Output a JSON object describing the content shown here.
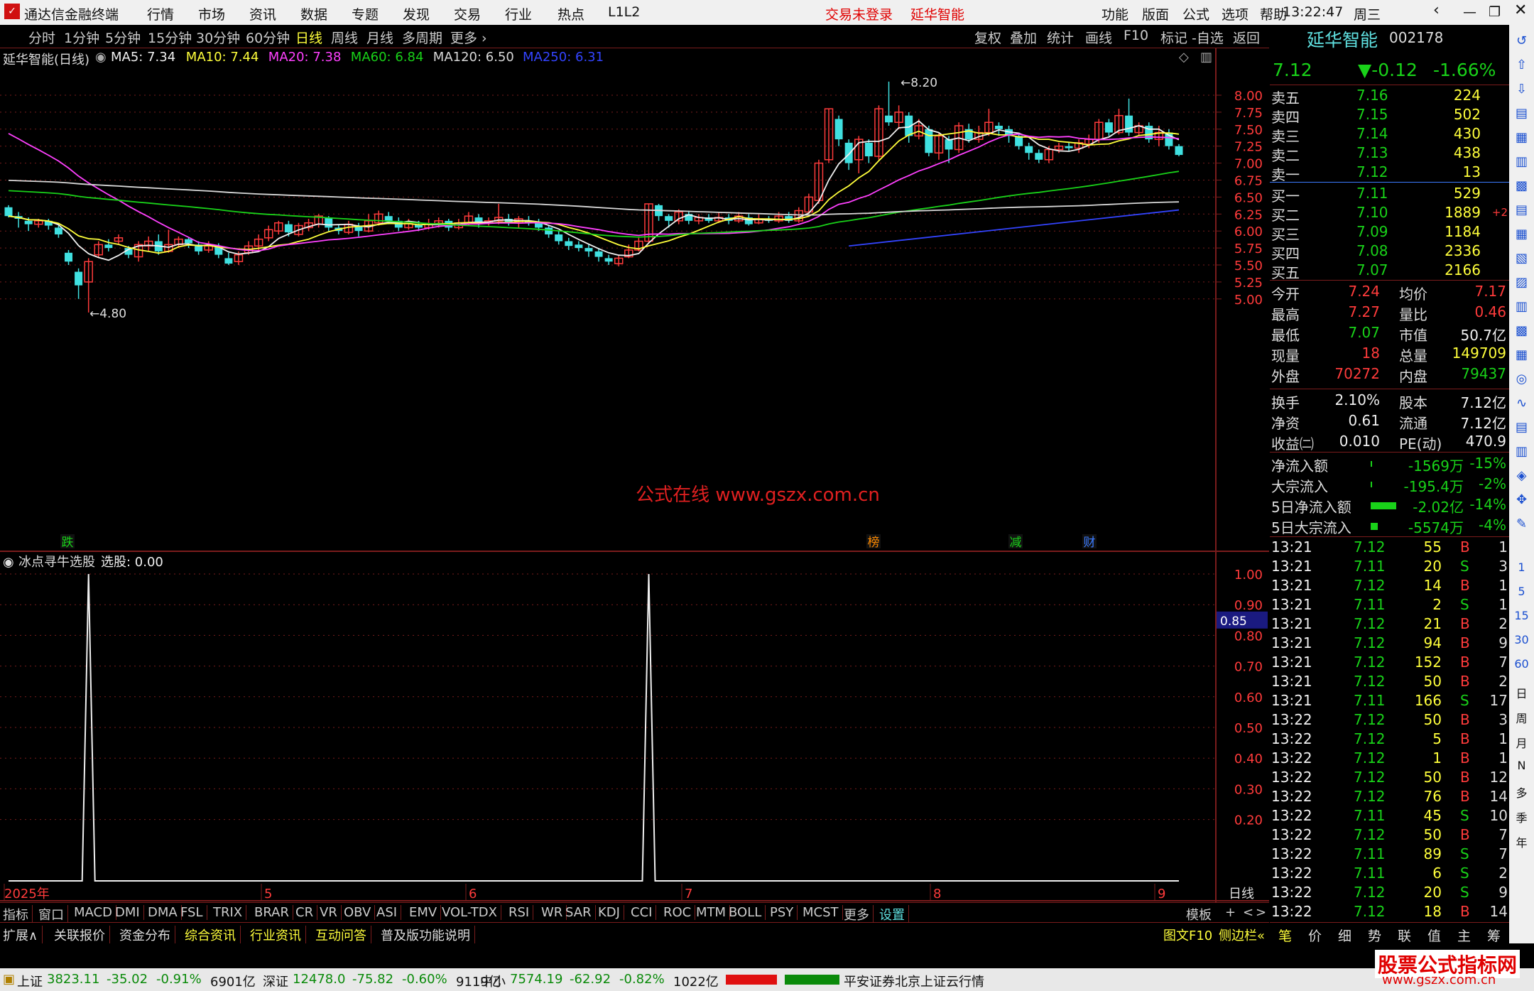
{
  "titlebar": {
    "app": "通达信金融终端",
    "menus": [
      "行情",
      "市场",
      "资讯",
      "数据",
      "专题",
      "发现",
      "交易",
      "行业",
      "热点",
      "L1L2"
    ],
    "login": "交易未登录",
    "stock": "延华智能",
    "right": [
      "功能",
      "版面",
      "公式",
      "选项",
      "帮助"
    ],
    "time": "13:22:47",
    "weekday": "周三"
  },
  "toolbar": {
    "periods": [
      "分时",
      "1分钟",
      "5分钟",
      "15分钟",
      "30分钟",
      "60分钟",
      "日线",
      "周线",
      "月线",
      "多周期",
      "更多"
    ],
    "active": "日线",
    "tools": [
      "复权",
      "叠加",
      "统计",
      "画线",
      "F10",
      "标记",
      "-自选",
      "返回"
    ]
  },
  "ma_info": {
    "name": "延华智能(日线)",
    "items": [
      {
        "label": "MA5: 7.34",
        "color": "#f0f0f0"
      },
      {
        "label": "MA10: 7.44",
        "color": "#ffff3b"
      },
      {
        "label": "MA20: 7.38",
        "color": "#ff40ff"
      },
      {
        "label": "MA60: 6.84",
        "color": "#19d219"
      },
      {
        "label": "MA120: 6.50",
        "color": "#d8d8d8"
      },
      {
        "label": "MA250: 6.31",
        "color": "#3344ff"
      }
    ]
  },
  "chart_data": [
    {
      "type": "candlestick",
      "title": "延华智能(日线)",
      "y_ticks": [
        "8.00",
        "7.75",
        "7.50",
        "7.25",
        "7.00",
        "6.75",
        "6.50",
        "6.25",
        "6.00",
        "5.75",
        "5.50",
        "5.25",
        "5.00"
      ],
      "ylim": [
        4.75,
        8.25
      ],
      "x_ticks": [
        "2025年",
        "5",
        "6",
        "7",
        "8",
        "9"
      ],
      "period": "日线",
      "annotations": [
        "8.20",
        "4.80"
      ],
      "markers": [
        "跌",
        "榜",
        "减",
        "财"
      ],
      "watermark": "公式在线 www.gszx.com.cn",
      "candles": [
        [
          6.35,
          6.22,
          6.38,
          6.2
        ],
        [
          6.22,
          6.18,
          6.28,
          6.05
        ],
        [
          6.15,
          6.1,
          6.2,
          6.0
        ],
        [
          6.1,
          6.15,
          6.18,
          6.05
        ],
        [
          6.15,
          6.08,
          6.18,
          6.02
        ],
        [
          6.05,
          5.95,
          6.08,
          5.9
        ],
        [
          5.68,
          5.55,
          5.72,
          5.5
        ],
        [
          5.4,
          5.2,
          5.45,
          5.0
        ],
        [
          5.25,
          5.55,
          5.6,
          4.8
        ],
        [
          5.65,
          5.8,
          5.85,
          5.6
        ],
        [
          5.8,
          5.75,
          5.88,
          5.7
        ],
        [
          5.85,
          5.9,
          5.95,
          5.8
        ],
        [
          5.75,
          5.65,
          5.78,
          5.6
        ],
        [
          5.62,
          5.8,
          5.85,
          5.55
        ],
        [
          5.78,
          5.85,
          5.92,
          5.7
        ],
        [
          5.85,
          5.7,
          5.95,
          5.65
        ],
        [
          5.7,
          5.8,
          6.02,
          5.68
        ],
        [
          5.8,
          5.88,
          5.92,
          5.75
        ],
        [
          5.88,
          5.82,
          5.9,
          5.75
        ],
        [
          5.8,
          5.7,
          5.85,
          5.65
        ],
        [
          5.72,
          5.78,
          5.85,
          5.68
        ],
        [
          5.78,
          5.65,
          5.82,
          5.6
        ],
        [
          5.6,
          5.52,
          5.68,
          5.5
        ],
        [
          5.55,
          5.65,
          5.7,
          5.5
        ],
        [
          5.68,
          5.78,
          5.85,
          5.65
        ],
        [
          5.78,
          5.88,
          5.95,
          5.72
        ],
        [
          5.9,
          6.02,
          6.08,
          5.85
        ],
        [
          6.0,
          6.12,
          6.15,
          5.95
        ],
        [
          6.1,
          5.98,
          6.15,
          5.92
        ],
        [
          5.95,
          6.08,
          6.12,
          5.92
        ],
        [
          6.05,
          6.12,
          6.18,
          6.0
        ],
        [
          6.1,
          6.22,
          6.25,
          6.05
        ],
        [
          6.2,
          6.05,
          6.22,
          6.0
        ],
        [
          6.05,
          6.0,
          6.1,
          5.95
        ],
        [
          5.98,
          6.1,
          6.15,
          5.95
        ],
        [
          6.08,
          6.0,
          6.12,
          5.92
        ],
        [
          6.0,
          6.15,
          6.25,
          5.98
        ],
        [
          6.12,
          6.25,
          6.3,
          6.08
        ],
        [
          6.22,
          6.15,
          6.28,
          6.1
        ],
        [
          6.15,
          6.05,
          6.2,
          6.0
        ],
        [
          6.05,
          6.12,
          6.18,
          6.02
        ],
        [
          6.1,
          6.05,
          6.15,
          6.0
        ],
        [
          6.05,
          6.1,
          6.18,
          6.02
        ],
        [
          6.1,
          6.15,
          6.2,
          6.05
        ],
        [
          6.15,
          6.05,
          6.18,
          6.0
        ],
        [
          6.05,
          6.12,
          6.18,
          6.02
        ],
        [
          6.12,
          6.22,
          6.28,
          6.08
        ],
        [
          6.2,
          6.12,
          6.25,
          6.05
        ],
        [
          6.12,
          6.15,
          6.2,
          6.08
        ],
        [
          6.15,
          6.2,
          6.4,
          6.1
        ],
        [
          6.18,
          6.12,
          6.25,
          6.08
        ],
        [
          6.12,
          6.18,
          6.22,
          6.05
        ],
        [
          6.15,
          6.12,
          6.22,
          6.08
        ],
        [
          6.12,
          6.05,
          6.18,
          6.0
        ],
        [
          6.05,
          5.95,
          6.08,
          5.9
        ],
        [
          5.95,
          5.85,
          6.0,
          5.8
        ],
        [
          5.85,
          5.78,
          5.9,
          5.72
        ],
        [
          5.8,
          5.75,
          5.85,
          5.7
        ],
        [
          5.75,
          5.7,
          5.8,
          5.62
        ],
        [
          5.7,
          5.62,
          5.75,
          5.55
        ],
        [
          5.6,
          5.55,
          5.65,
          5.5
        ],
        [
          5.52,
          5.6,
          5.65,
          5.48
        ],
        [
          5.62,
          5.72,
          5.8,
          5.6
        ],
        [
          5.72,
          5.85,
          5.9,
          5.7
        ],
        [
          5.85,
          6.4,
          6.4,
          5.82
        ],
        [
          6.38,
          6.22,
          6.4,
          6.15
        ],
        [
          6.22,
          6.15,
          6.25,
          6.05
        ],
        [
          6.15,
          6.28,
          6.32,
          6.1
        ],
        [
          6.25,
          6.15,
          6.3,
          6.1
        ],
        [
          6.15,
          6.2,
          6.25,
          6.1
        ],
        [
          6.2,
          6.15,
          6.25,
          6.12
        ],
        [
          6.15,
          6.2,
          6.28,
          6.12
        ],
        [
          6.2,
          6.15,
          6.25,
          6.1
        ],
        [
          6.15,
          6.22,
          6.28,
          6.12
        ],
        [
          6.2,
          6.1,
          6.25,
          6.08
        ],
        [
          6.12,
          6.18,
          6.25,
          6.1
        ],
        [
          6.18,
          6.15,
          6.22,
          6.12
        ],
        [
          6.15,
          6.22,
          6.28,
          6.12
        ],
        [
          6.22,
          6.15,
          6.28,
          6.12
        ],
        [
          6.15,
          6.3,
          6.35,
          6.12
        ],
        [
          6.28,
          6.5,
          6.55,
          6.25
        ],
        [
          6.45,
          7.0,
          7.05,
          6.4
        ],
        [
          7.05,
          7.8,
          7.8,
          7.0
        ],
        [
          7.65,
          7.35,
          7.7,
          7.25
        ],
        [
          7.3,
          7.0,
          7.35,
          6.9
        ],
        [
          7.05,
          7.35,
          7.4,
          6.85
        ],
        [
          7.3,
          7.1,
          7.35,
          7.0
        ],
        [
          7.1,
          7.8,
          7.85,
          7.05
        ],
        [
          7.7,
          7.6,
          8.2,
          7.55
        ],
        [
          7.6,
          7.75,
          7.85,
          7.5
        ],
        [
          7.7,
          7.4,
          7.75,
          7.3
        ],
        [
          7.4,
          7.55,
          7.65,
          7.35
        ],
        [
          7.5,
          7.15,
          7.55,
          7.1
        ],
        [
          7.15,
          7.4,
          7.45,
          7.05
        ],
        [
          7.35,
          7.2,
          7.4,
          7.0
        ],
        [
          7.2,
          7.55,
          7.6,
          7.15
        ],
        [
          7.5,
          7.35,
          7.58,
          7.3
        ],
        [
          7.35,
          7.45,
          7.55,
          7.3
        ],
        [
          7.45,
          7.6,
          7.8,
          7.4
        ],
        [
          7.55,
          7.5,
          7.6,
          7.4
        ],
        [
          7.5,
          7.4,
          7.55,
          7.3
        ],
        [
          7.4,
          7.25,
          7.45,
          7.2
        ],
        [
          7.25,
          7.15,
          7.3,
          7.05
        ],
        [
          7.15,
          7.05,
          7.2,
          7.0
        ],
        [
          7.05,
          7.2,
          7.25,
          7.0
        ],
        [
          7.2,
          7.25,
          7.3,
          7.15
        ],
        [
          7.25,
          7.22,
          7.3,
          7.18
        ],
        [
          7.22,
          7.3,
          7.35,
          7.15
        ],
        [
          7.28,
          7.35,
          7.42,
          7.22
        ],
        [
          7.35,
          7.6,
          7.65,
          7.3
        ],
        [
          7.6,
          7.45,
          7.65,
          7.4
        ],
        [
          7.45,
          7.7,
          7.8,
          7.42
        ],
        [
          7.7,
          7.45,
          7.95,
          7.4
        ],
        [
          7.45,
          7.55,
          7.6,
          7.4
        ],
        [
          7.55,
          7.35,
          7.6,
          7.3
        ],
        [
          7.35,
          7.45,
          7.55,
          7.25
        ],
        [
          7.45,
          7.25,
          7.5,
          7.2
        ],
        [
          7.25,
          7.12,
          7.28,
          7.1
        ]
      ]
    },
    {
      "type": "line",
      "title": "冰点寻牛选股",
      "readout": "选股: 0.00",
      "y_ticks": [
        "1.00",
        "0.90",
        "0.80",
        "0.70",
        "0.60",
        "0.50",
        "0.40",
        "0.30",
        "0.20"
      ],
      "ylim": [
        0,
        1.05
      ],
      "current": "0.85",
      "spikes_at_index": [
        8,
        64
      ]
    }
  ],
  "indicators": [
    "指标",
    "窗口",
    "MACD",
    "DMI",
    "DMA",
    "FSL",
    "TRIX",
    "BRAR",
    "CR",
    "VR",
    "OBV",
    "ASI",
    "EMV",
    "VOL-TDX",
    "RSI",
    "WR",
    "SAR",
    "KDJ",
    "CCI",
    "ROC",
    "MTM",
    "BOLL",
    "PSY",
    "MCST",
    "更多",
    "设置"
  ],
  "indicator_right": [
    "模板",
    "+",
    "<",
    ">"
  ],
  "expand_bar": [
    {
      "t": "扩展∧",
      "c": "#ddd"
    },
    {
      "t": "关联报价",
      "c": "#ddd"
    },
    {
      "t": "资金分布",
      "c": "#ddd"
    },
    {
      "t": "综合资讯",
      "c": "#ffff3b"
    },
    {
      "t": "行业资讯",
      "c": "#ffff3b"
    },
    {
      "t": "互动问答",
      "c": "#ffff3b"
    },
    {
      "t": "普及版功能说明",
      "c": "#ddd"
    }
  ],
  "expand_right": [
    "图文F10",
    "侧边栏"
  ],
  "quote": {
    "name": "延华智能",
    "code": "002178",
    "price": "7.12",
    "change": "▼-0.12",
    "pct": "-1.66%",
    "sell": [
      [
        "卖五",
        "7.16",
        "224"
      ],
      [
        "卖四",
        "7.15",
        "502"
      ],
      [
        "卖三",
        "7.14",
        "430"
      ],
      [
        "卖二",
        "7.13",
        "438"
      ],
      [
        "卖一",
        "7.12",
        "13"
      ]
    ],
    "buy": [
      [
        "买一",
        "7.11",
        "529",
        ""
      ],
      [
        "买二",
        "7.10",
        "1889",
        "+2"
      ],
      [
        "买三",
        "7.09",
        "1184",
        ""
      ],
      [
        "买四",
        "7.08",
        "2336",
        ""
      ],
      [
        "买五",
        "7.07",
        "2166",
        ""
      ]
    ],
    "stats": [
      [
        "今开",
        "7.24",
        "均价",
        "7.17"
      ],
      [
        "最高",
        "7.27",
        "量比",
        "0.46"
      ],
      [
        "最低",
        "7.07",
        "市值",
        "50.7亿"
      ],
      [
        "现量",
        "18",
        "总量",
        "149709"
      ],
      [
        "外盘",
        "70272",
        "内盘",
        "79437"
      ],
      [
        "换手",
        "2.10%",
        "股本",
        "7.12亿"
      ],
      [
        "净资",
        "0.61",
        "流通",
        "7.12亿"
      ],
      [
        "收益㈡",
        "0.010",
        "PE(动)",
        "470.9"
      ]
    ],
    "flows": [
      [
        "净流入额",
        "-1569万",
        "-15%"
      ],
      [
        "大宗流入",
        "-195.4万",
        "-2%"
      ],
      [
        "5日净流入额",
        "-2.02亿",
        "-14%"
      ],
      [
        "5日大宗流入",
        "-5574万",
        "-4%"
      ]
    ],
    "ticks": [
      [
        "13:21",
        "7.12",
        "55",
        "B",
        "1"
      ],
      [
        "13:21",
        "7.11",
        "20",
        "S",
        "3"
      ],
      [
        "13:21",
        "7.12",
        "14",
        "B",
        "1"
      ],
      [
        "13:21",
        "7.11",
        "2",
        "S",
        "1"
      ],
      [
        "13:21",
        "7.12",
        "21",
        "B",
        "2"
      ],
      [
        "13:21",
        "7.12",
        "94",
        "B",
        "9"
      ],
      [
        "13:21",
        "7.12",
        "152",
        "B",
        "7"
      ],
      [
        "13:21",
        "7.12",
        "50",
        "B",
        "2"
      ],
      [
        "13:21",
        "7.11",
        "166",
        "S",
        "17"
      ],
      [
        "13:22",
        "7.12",
        "50",
        "B",
        "3"
      ],
      [
        "13:22",
        "7.12",
        "5",
        "B",
        "1"
      ],
      [
        "13:22",
        "7.12",
        "1",
        "B",
        "1"
      ],
      [
        "13:22",
        "7.12",
        "50",
        "B",
        "12"
      ],
      [
        "13:22",
        "7.12",
        "76",
        "B",
        "14"
      ],
      [
        "13:22",
        "7.11",
        "45",
        "S",
        "10"
      ],
      [
        "13:22",
        "7.12",
        "50",
        "B",
        "7"
      ],
      [
        "13:22",
        "7.11",
        "89",
        "S",
        "7"
      ],
      [
        "13:22",
        "7.11",
        "6",
        "S",
        "2"
      ],
      [
        "13:22",
        "7.12",
        "20",
        "S",
        "9"
      ],
      [
        "13:22",
        "7.12",
        "18",
        "B",
        "14"
      ]
    ],
    "tabs": [
      "笔",
      "价",
      "细",
      "势",
      "联",
      "值",
      "主",
      "筹"
    ]
  },
  "sidebar": {
    "labels": [
      "日",
      "周",
      "月",
      "N",
      "多",
      "季",
      "年"
    ],
    "numbers": [
      "1",
      "5",
      "15",
      "30",
      "60"
    ]
  },
  "status": {
    "indexes": [
      {
        "name": "上证",
        "val": "3823.11",
        "chg": "-35.02",
        "pct": "-0.91%",
        "amt": "6901亿"
      },
      {
        "name": "深证",
        "val": "12478.0",
        "chg": "-75.82",
        "pct": "-0.60%",
        "amt": "9119亿"
      },
      {
        "name": "中小",
        "val": "7574.19",
        "chg": "-62.92",
        "pct": "-0.82%",
        "amt": "1022亿"
      }
    ],
    "broker": "平安证券北京上证云行情",
    "brand": "股票公式指标网",
    "brand_url": "www.gszx.com.cn"
  },
  "colors": {
    "up": "#ff3b3b",
    "down": "#40e0e0",
    "grid": "#7a1c1c",
    "ma5": "#f0f0f0",
    "ma10": "#ffff3b",
    "ma20": "#ff40ff",
    "ma60": "#19d219",
    "ma120": "#d8d8d8",
    "ma250": "#3344ff"
  }
}
